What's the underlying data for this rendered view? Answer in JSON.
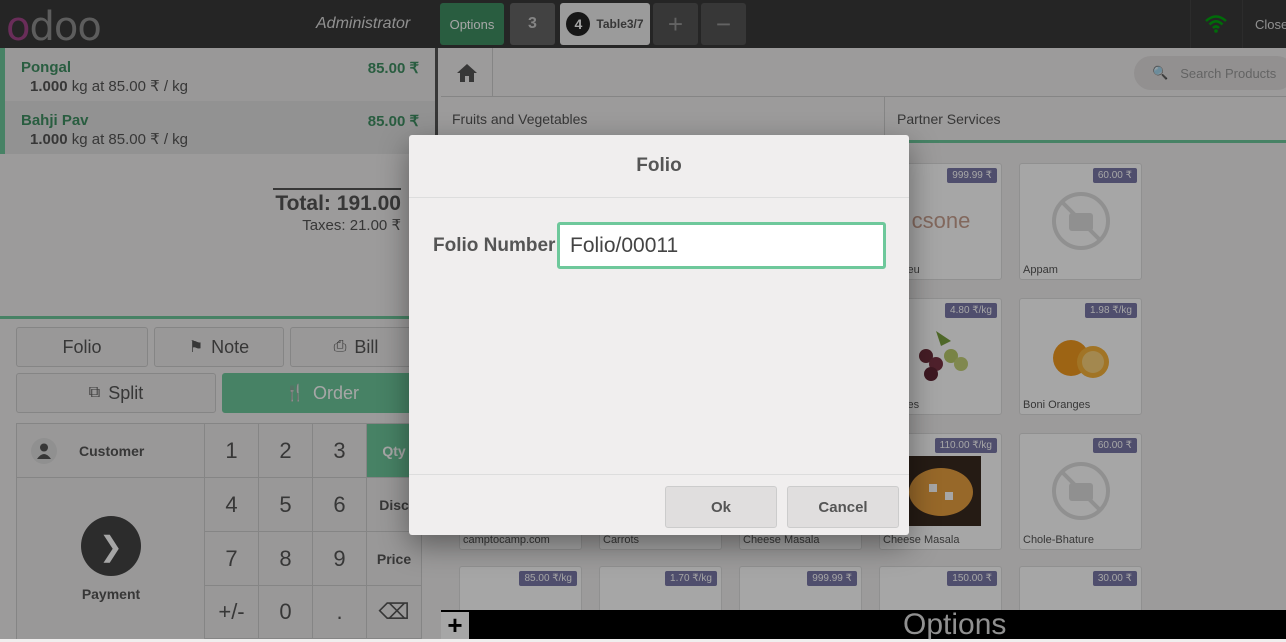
{
  "header": {
    "logo_text": "odoo",
    "user": "Administrator",
    "tabs": [
      {
        "label": "Options"
      },
      {
        "label": "3"
      },
      {
        "number": "4",
        "label": "Table3/7"
      }
    ],
    "add_label": "+",
    "remove_label": "−",
    "close_label": "Close",
    "wifi_color": "#00a60e"
  },
  "order": {
    "lines": [
      {
        "name": "Pongal",
        "price": "85.00 ₹",
        "qty": "1.000",
        "detail": " kg at 85.00 ₹ / kg"
      },
      {
        "name": "Bahji Pav",
        "price": "85.00 ₹",
        "qty": "1.000",
        "detail": " kg at 85.00 ₹ / kg"
      }
    ],
    "total": "Total: 191.00",
    "taxes": "Taxes: 21.00 ₹"
  },
  "controls": {
    "folio": "Folio",
    "note": "Note",
    "bill": "Bill",
    "split": "Split",
    "order": "Order",
    "customer": "Customer",
    "payment": "Payment",
    "keys": [
      "1",
      "2",
      "3",
      "Qty",
      "4",
      "5",
      "6",
      "Disc",
      "7",
      "8",
      "9",
      "Price",
      "+/-",
      "0",
      ".",
      "⌫"
    ]
  },
  "products_panel": {
    "search_placeholder": "Search Products",
    "categories": [
      "Fruits and Vegetables",
      "Partner Services"
    ],
    "products": [
      {
        "name": "...ne.eu",
        "price": "999.99 ₹",
        "logo": "csone"
      },
      {
        "name": "Appam",
        "price": "60.00 ₹"
      },
      {
        "name": "Grapes",
        "price": "4.80 ₹/kg"
      },
      {
        "name": "Boni Oranges",
        "price": "1.98 ₹/kg"
      },
      {
        "name": "Cheese Masala",
        "price": "110.00 ₹/kg"
      },
      {
        "name": "Chole-Bhature",
        "price": "60.00 ₹"
      },
      {
        "name": "camptocamp.com",
        "price": ""
      },
      {
        "name": "Carrots",
        "price": ""
      },
      {
        "name": "Cheese Masala",
        "price": ""
      },
      {
        "name": "",
        "price": "85.00 ₹/kg"
      },
      {
        "name": "",
        "price": "1.70 ₹/kg"
      },
      {
        "name": "",
        "price": "999.99 ₹"
      },
      {
        "name": "",
        "price": "150.00 ₹"
      },
      {
        "name": "",
        "price": "30.00 ₹"
      }
    ]
  },
  "bottom_bar": {
    "plus": "+",
    "title": "Options"
  },
  "modal": {
    "title": "Folio",
    "field_label": "Folio Number",
    "field_value": "Folio/00011",
    "ok": "Ok",
    "cancel": "Cancel"
  },
  "colors": {
    "accent": "#6ec89b",
    "price_badge": "#7a78a8"
  }
}
